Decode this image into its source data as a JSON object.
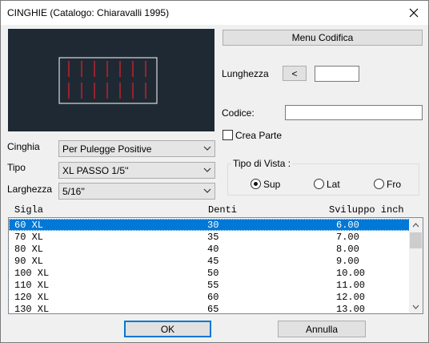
{
  "window": {
    "title": "CINGHIE (Catalogo: Chiaravalli 1995)"
  },
  "buttons": {
    "menu_codifica": "Menu Codifica",
    "lunghezza_step": "<",
    "ok": "OK",
    "annulla": "Annulla"
  },
  "fields": {
    "lunghezza_label": "Lunghezza",
    "lunghezza_value": "",
    "codice_label": "Codice:",
    "codice_value": "",
    "crea_parte_label": "Crea Parte",
    "crea_parte_checked": false
  },
  "combos": {
    "cinghia_label": "Cinghia",
    "cinghia_value": "Per Pulegge Positive",
    "tipo_label": "Tipo",
    "tipo_value": "XL PASSO 1/5''",
    "larghezza_label": "Larghezza",
    "larghezza_value": "5/16''"
  },
  "vista": {
    "title": "Tipo di Vista :",
    "options": [
      "Sup",
      "Lat",
      "Fro"
    ],
    "selected": "Sup"
  },
  "table": {
    "headers": [
      "Sigla",
      "Denti",
      "Sviluppo inch"
    ],
    "rows": [
      [
        "60 XL",
        "30",
        "6.00"
      ],
      [
        "70 XL",
        "35",
        "7.00"
      ],
      [
        "80 XL",
        "40",
        "8.00"
      ],
      [
        "90 XL",
        "45",
        "9.00"
      ],
      [
        "100 XL",
        "50",
        "10.00"
      ],
      [
        "110 XL",
        "55",
        "11.00"
      ],
      [
        "120 XL",
        "60",
        "12.00"
      ],
      [
        "130 XL",
        "65",
        "13.00"
      ]
    ],
    "selected_index": 0
  },
  "colors": {
    "preview_bg": "#1f2933",
    "belt_outline": "#ffffff",
    "teeth": "#e8202a",
    "selection": "#0078d7"
  }
}
